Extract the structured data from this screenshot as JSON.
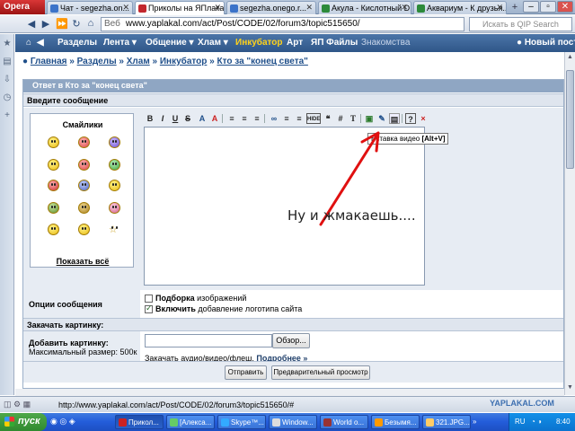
{
  "browser": {
    "opera_label": "Opera",
    "tabs": [
      {
        "label": "Чат - segezha.on...",
        "active": false,
        "color": "#3b73c9"
      },
      {
        "label": "Приколы на ЯПлакалъ...",
        "active": true,
        "color": "#c2272d"
      },
      {
        "label": "segezha.onego.r...",
        "active": false,
        "color": "#3b73c9"
      },
      {
        "label": "Акула - Кислотный D...",
        "active": false,
        "color": "#2c8a3a"
      },
      {
        "label": "Аквариум - К друзья...",
        "active": false,
        "color": "#2c8a3a"
      }
    ],
    "url_prefix": "Веб",
    "url": "www.yaplakal.com/act/Post/CODE/02/forum3/topic515650/",
    "search_placeholder": "Искать в QIP Search"
  },
  "sitenav": {
    "items": [
      {
        "label": "Разделы",
        "style": "normal"
      },
      {
        "label": "Лента ▾",
        "style": "normal"
      },
      {
        "label": "Общение ▾",
        "style": "normal"
      },
      {
        "label": "Хлам ▾",
        "style": "normal"
      },
      {
        "label": "Инкубатор",
        "style": "hl"
      },
      {
        "label": "Арт",
        "style": "normal"
      },
      {
        "label": "ЯП Файлы",
        "style": "normal"
      },
      {
        "label": "Знакомства",
        "style": "dim"
      },
      {
        "label": "Новый пост",
        "style": "normal"
      }
    ]
  },
  "breadcrumb": [
    "Главная",
    "Разделы",
    "Хлам",
    "Инкубатор",
    "Кто за \"конец света\""
  ],
  "form": {
    "title": "Ответ в Кто за \"конец света\"",
    "enter_message": "Введите сообщение",
    "smileys_title": "Смайлики",
    "show_all": "Показать всё",
    "tooltip_text": "Вставка видео",
    "tooltip_key": "[Alt+V]",
    "overlay_text": "Ну и жмакаешь....",
    "options_label": "Опции сообщения",
    "opt1_bold": "Подборка",
    "opt1_rest": "изображений",
    "opt2_bold": "Включить",
    "opt2_rest": "добавление логотипа сайта",
    "upload_section": "Закачать картинку:",
    "add_picture_label": "Добавить картинку:",
    "max_size": "Максимальный размер: 500к",
    "browse_label": "Обзор...",
    "audio_text": "Закачать аудио/видео/флеш.",
    "more_link": "Подробнее »",
    "send_button": "Отправить",
    "preview_button": "Предварительный просмотр"
  },
  "toolbar": [
    "B",
    "I",
    "U",
    "S",
    "A",
    "A",
    "≡",
    "≡",
    "≡",
    "≡",
    "≡",
    "❝",
    "#",
    "T",
    "▣",
    "✎",
    "▤",
    "?",
    "×"
  ],
  "status": {
    "url": "http://www.yaplakal.com/act/Post/CODE/02/forum3/topic515650/#",
    "watermark": "YAPLAKAL.COM"
  },
  "taskbar": {
    "start": "пуск",
    "tasks": [
      "Прикол...",
      "[Алекса...",
      "Skype™...",
      "Window...",
      "World o...",
      "Безымя...",
      "321.JPG..."
    ],
    "lang": "RU",
    "time": "8:40"
  }
}
